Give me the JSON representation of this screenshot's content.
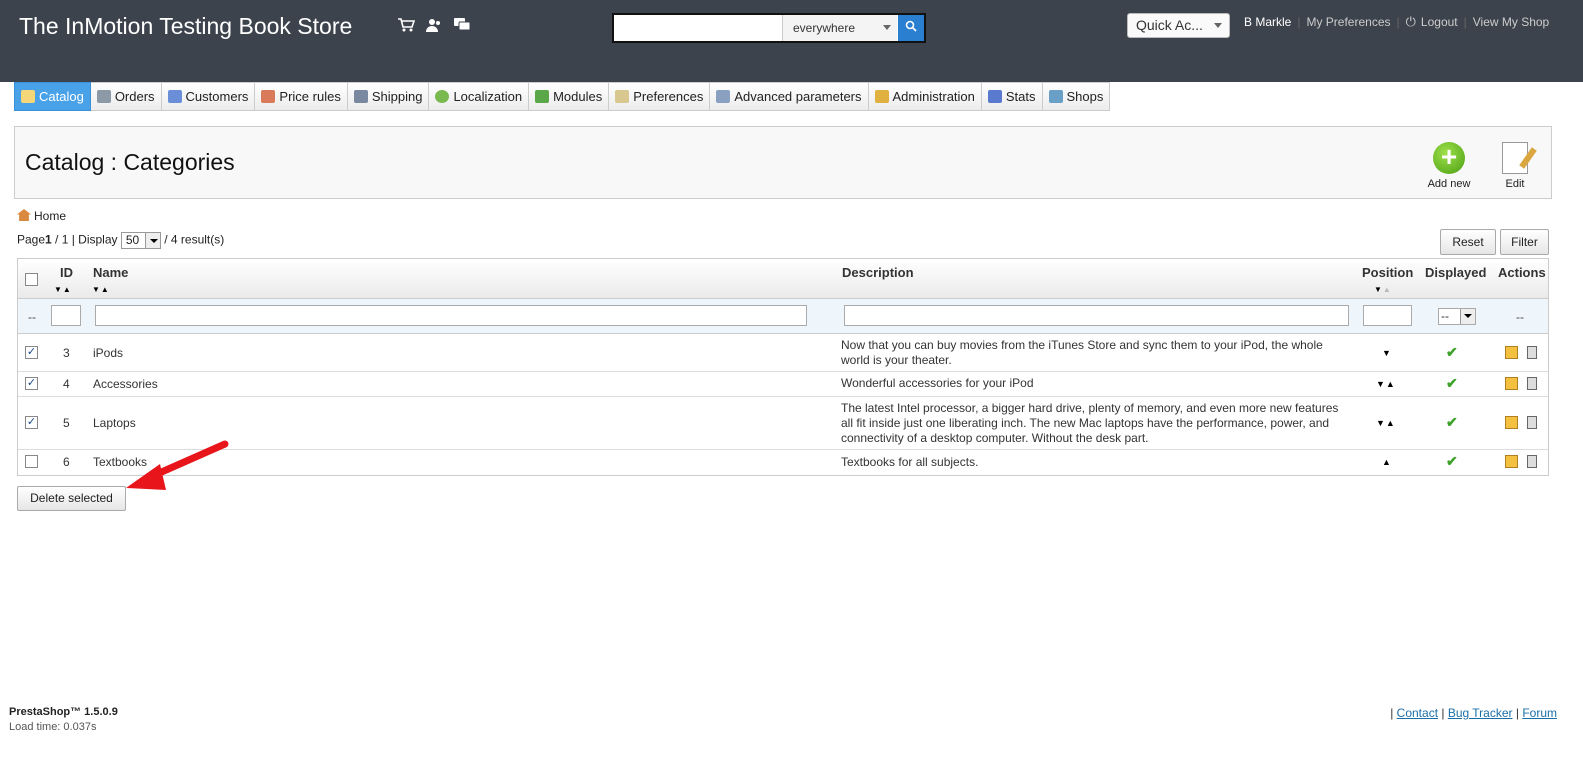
{
  "header": {
    "shop_title": "The InMotion Testing Book Store",
    "search": {
      "value": "",
      "scope": "everywhere"
    },
    "quick_access": "Quick Ac...",
    "user_name": "B Markle",
    "my_preferences": "My Preferences",
    "logout": "Logout",
    "view_my_shop": "View My Shop",
    "header_icons": [
      "cart-icon",
      "customers-icon",
      "messages-icon"
    ]
  },
  "tabs": [
    {
      "label": "Catalog",
      "icon": "folder-icon",
      "active": true
    },
    {
      "label": "Orders",
      "icon": "cart-icon"
    },
    {
      "label": "Customers",
      "icon": "customer-icon"
    },
    {
      "label": "Price rules",
      "icon": "price-rules-icon"
    },
    {
      "label": "Shipping",
      "icon": "truck-icon"
    },
    {
      "label": "Localization",
      "icon": "globe-icon"
    },
    {
      "label": "Modules",
      "icon": "puzzle-icon"
    },
    {
      "label": "Preferences",
      "icon": "preferences-icon"
    },
    {
      "label": "Advanced parameters",
      "icon": "wrench-icon"
    },
    {
      "label": "Administration",
      "icon": "key-icon"
    },
    {
      "label": "Stats",
      "icon": "chart-icon"
    },
    {
      "label": "Shops",
      "icon": "shop-icon"
    }
  ],
  "page": {
    "title": "Catalog : Categories",
    "add_new": "Add new",
    "edit": "Edit",
    "breadcrumb_home": "Home",
    "pagination": {
      "page_label": "Page",
      "current": "1",
      "total_suffix": " / 1 | Display",
      "per_page": "50",
      "results": "/ 4 result(s)"
    },
    "reset": "Reset",
    "filter": "Filter",
    "delete_selected": "Delete selected"
  },
  "table": {
    "headers": {
      "id": "ID",
      "name": "Name",
      "description": "Description",
      "position": "Position",
      "displayed": "Displayed",
      "actions": "Actions"
    },
    "filter_placeholder_dash": "--",
    "displayed_filter": "--",
    "rows": [
      {
        "checked": true,
        "id": "3",
        "name": "iPods",
        "description": "Now that you can buy movies from the iTunes Store and sync them to your iPod, the whole world is your theater.",
        "position": "down"
      },
      {
        "checked": true,
        "id": "4",
        "name": "Accessories",
        "description": "Wonderful accessories for your iPod",
        "position": "both"
      },
      {
        "checked": true,
        "id": "5",
        "name": "Laptops",
        "description": "The latest Intel processor, a bigger hard drive, plenty of memory, and even more new features all fit inside just one liberating inch. The new Mac laptops have the performance, power, and connectivity of a desktop computer. Without the desk part.",
        "position": "both"
      },
      {
        "checked": false,
        "id": "6",
        "name": "Textbooks",
        "description": "Textbooks for all subjects.",
        "position": "up"
      }
    ]
  },
  "footer": {
    "version": "PrestaShop™ 1.5.0.9",
    "load_time": "Load time: 0.037s",
    "contact": "Contact",
    "bug_tracker": "Bug Tracker",
    "forum": "Forum"
  },
  "colors": {
    "header_bg": "#3d434d",
    "active_tab": "#49a2e8",
    "annotation_arrow": "#e8151b"
  }
}
